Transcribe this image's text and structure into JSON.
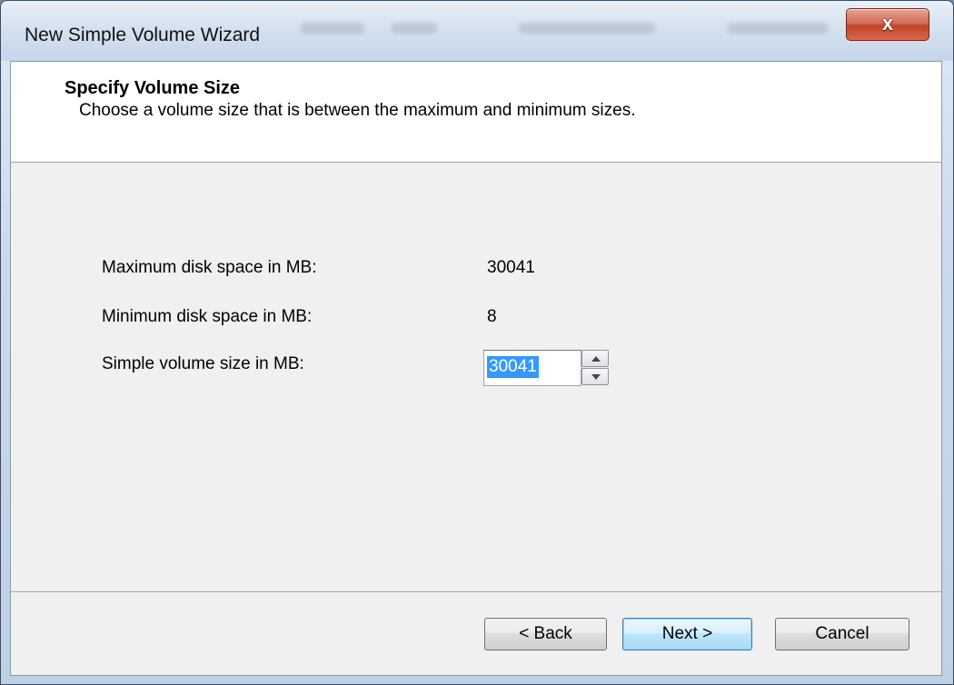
{
  "window": {
    "title": "New Simple Volume Wizard",
    "close_glyph": "x"
  },
  "header": {
    "title": "Specify Volume Size",
    "subtitle": "Choose a volume size that is between the maximum and minimum sizes."
  },
  "fields": {
    "max_label": "Maximum disk space in MB:",
    "max_value": "30041",
    "min_label": "Minimum disk space in MB:",
    "min_value": "8",
    "size_label": "Simple volume size in MB:",
    "size_value": "30041"
  },
  "buttons": {
    "back": "< Back",
    "next": "Next >",
    "cancel": "Cancel"
  },
  "colors": {
    "selection": "#3399ff",
    "close_button": "#c2432a",
    "default_button_border": "#3c7fb1"
  }
}
